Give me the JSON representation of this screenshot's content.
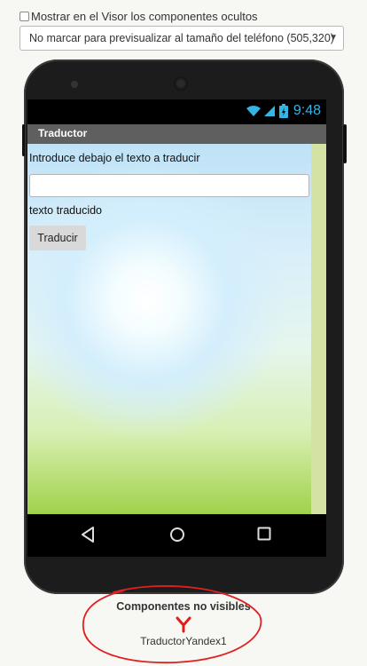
{
  "viewer_options": {
    "show_hidden_label": "Mostrar en el Visor los componentes ocultos",
    "show_hidden_checked": false,
    "preview_size_value": "No marcar para previsualizar al tamaño del teléfono (505,320)"
  },
  "phone": {
    "status_time": "9:48",
    "app_title": "Traductor",
    "screen": {
      "intro_label": "Introduce debajo el texto a traducir",
      "text_input_value": "",
      "translated_label": "texto traducido",
      "translate_button": "Traducir"
    },
    "nav": {
      "back_icon": "back-triangle-icon",
      "home_icon": "home-circle-icon",
      "recents_icon": "recents-square-icon"
    }
  },
  "non_visible": {
    "title": "Componentes no visibles",
    "component_label": "TraductorYandex1",
    "component_icon": "yandex-icon"
  },
  "colors": {
    "status_accent": "#33b5e5",
    "title_bar": "#5f5f5f",
    "annotation_circle": "#e02020",
    "yandex_red": "#e21a1a"
  }
}
